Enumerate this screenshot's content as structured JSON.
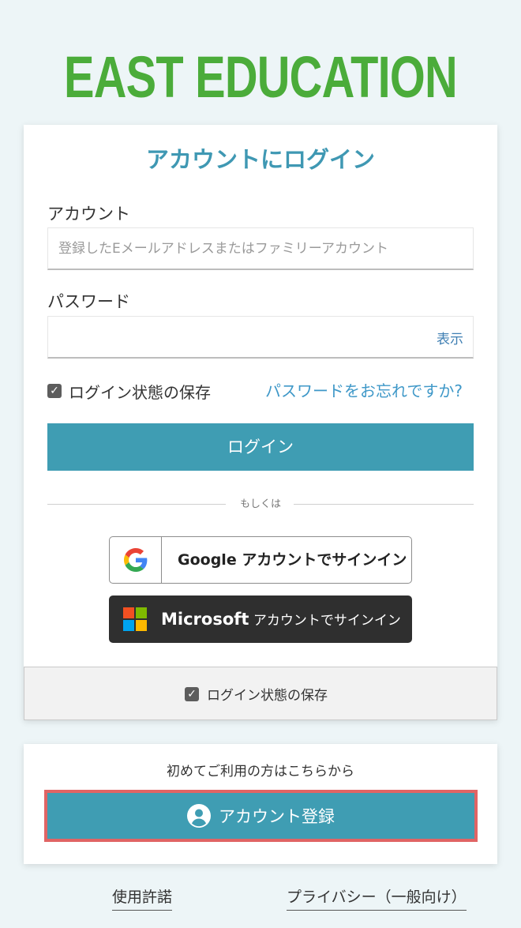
{
  "brand": {
    "logo_text": "EAST EDUCATION"
  },
  "login": {
    "title": "アカウントにログイン",
    "account_label": "アカウント",
    "account_placeholder": "登録したEメールアドレスまたはファミリーアカウント",
    "password_label": "パスワード",
    "password_value": "",
    "show_label": "表示",
    "remember_label": "ログイン状態の保存",
    "remember_checked": true,
    "forgot_label": "パスワードをお忘れですか?",
    "login_button": "ログイン",
    "divider_text": "もしくは",
    "google_button": "Google アカウントでサインイン",
    "microsoft_brand": "Microsoft",
    "microsoft_suffix": " アカウントでサインイン",
    "footer_remember_label": "ログイン状態の保存"
  },
  "register": {
    "prompt": "初めてご利用の方はこちらから",
    "button": "アカウント登録"
  },
  "links": {
    "terms": "使用許諾",
    "privacy": "プライバシー（一般向け）"
  },
  "colors": {
    "logo": "#4bac3a",
    "accent": "#3f9db3",
    "title": "#3f98b3",
    "link": "#3f98c8",
    "highlight_border": "#e06464",
    "microsoft_bg": "#2f2f2f"
  },
  "icons": {
    "checkbox": "check-icon",
    "google": "google-g-icon",
    "microsoft": "microsoft-logo-icon",
    "user": "user-circle-icon"
  }
}
